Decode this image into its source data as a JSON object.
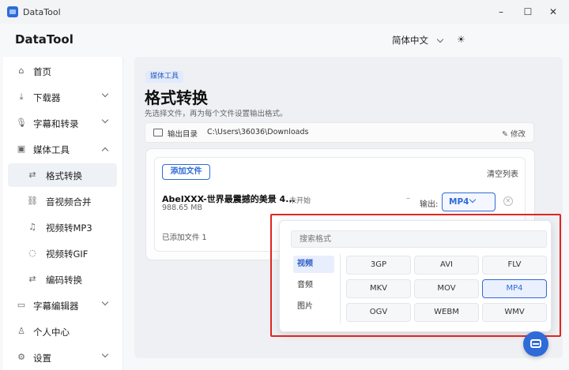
{
  "window": {
    "title": "DataTool",
    "minimize": "–",
    "maximize": "☐",
    "close": "✕"
  },
  "header": {
    "brand": "DataTool",
    "language": "简体中文",
    "theme_icon": "☀"
  },
  "sidebar": {
    "items": [
      {
        "label": "首页",
        "icon": "home-icon",
        "glyph": "⌂"
      },
      {
        "label": "下载器",
        "icon": "download-icon",
        "glyph": "⤓"
      },
      {
        "label": "字幕和转录",
        "icon": "mic-icon",
        "glyph": "🎙"
      },
      {
        "label": "媒体工具",
        "icon": "video-icon",
        "glyph": "▣"
      },
      {
        "label": "格式转换",
        "icon": "swap-icon",
        "glyph": "⇄"
      },
      {
        "label": "音视频合并",
        "icon": "link-icon",
        "glyph": "⛓"
      },
      {
        "label": "视频转MP3",
        "icon": "music-icon",
        "glyph": "♫"
      },
      {
        "label": "视频转GIF",
        "icon": "bulb-icon",
        "glyph": "◌"
      },
      {
        "label": "编码转换",
        "icon": "swap-icon",
        "glyph": "⇄"
      },
      {
        "label": "字幕编辑器",
        "icon": "subtitle-icon",
        "glyph": "▭"
      },
      {
        "label": "个人中心",
        "icon": "user-icon",
        "glyph": "♙"
      },
      {
        "label": "设置",
        "icon": "gear-icon",
        "glyph": "⚙"
      }
    ]
  },
  "main": {
    "tag": "媒体工具",
    "title": "格式转换",
    "subtitle": "先选择文件，再为每个文件设置输出格式。",
    "output_dir": {
      "label": "输出目录",
      "path": "C:\\Users\\36036\\Downloads",
      "edit": "修改"
    },
    "add_file": "添加文件",
    "clear_list": "清空列表",
    "file": {
      "name": "AbelXXX-世界最震撼的美景 4...",
      "size": "988.65 MB",
      "status": "未开始",
      "output_label": "输出:",
      "format": "MP4"
    },
    "added_count": "已添加文件 1"
  },
  "format_popup": {
    "search_placeholder": "搜索格式",
    "categories": [
      "视频",
      "音频",
      "图片"
    ],
    "active_category": "视频",
    "formats": [
      "3GP",
      "AVI",
      "FLV",
      "MKV",
      "MOV",
      "MP4",
      "OGV",
      "WEBM",
      "WMV"
    ],
    "selected": "MP4"
  },
  "colors": {
    "accent": "#2f6bd8",
    "highlight": "#e0251f"
  }
}
